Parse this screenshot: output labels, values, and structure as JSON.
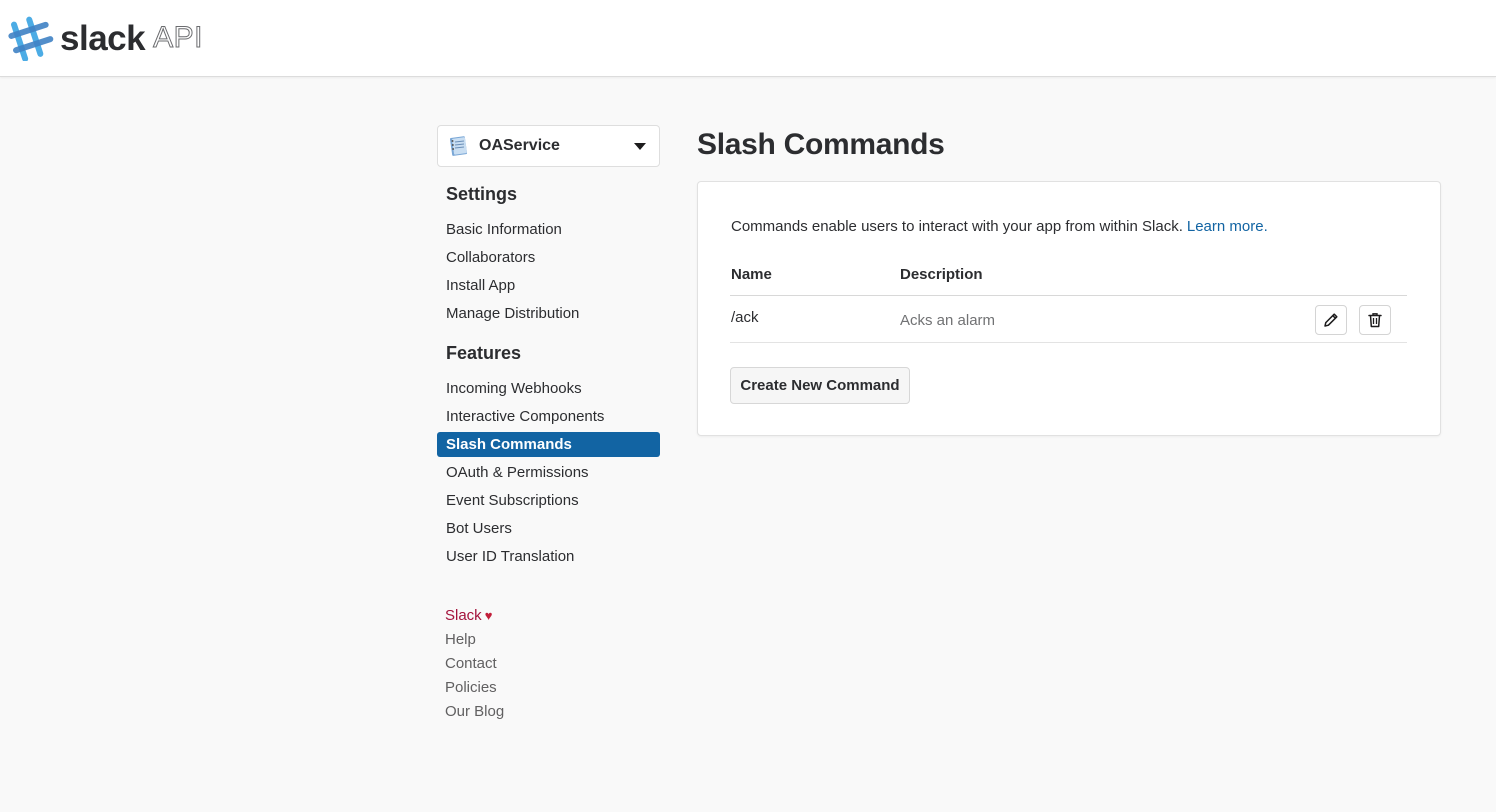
{
  "header": {
    "logo_word": "slack",
    "logo_suffix": "API"
  },
  "app_selector": {
    "app_name": "OAService"
  },
  "sidebar": {
    "settings_heading": "Settings",
    "settings_items": [
      {
        "label": "Basic Information"
      },
      {
        "label": "Collaborators"
      },
      {
        "label": "Install App"
      },
      {
        "label": "Manage Distribution"
      }
    ],
    "features_heading": "Features",
    "features_items": [
      {
        "label": "Incoming Webhooks"
      },
      {
        "label": "Interactive Components"
      },
      {
        "label": "Slash Commands",
        "active": true
      },
      {
        "label": "OAuth & Permissions"
      },
      {
        "label": "Event Subscriptions"
      },
      {
        "label": "Bot Users"
      },
      {
        "label": "User ID Translation"
      }
    ],
    "footer": {
      "slack": "Slack",
      "help": "Help",
      "contact": "Contact",
      "policies": "Policies",
      "blog": "Our Blog"
    }
  },
  "main": {
    "title": "Slash Commands",
    "intro_text": "Commands enable users to interact with your app from within Slack.",
    "learn_more": "Learn more.",
    "columns": {
      "name": "Name",
      "description": "Description"
    },
    "commands": [
      {
        "name": "/ack",
        "description": "Acks an alarm"
      }
    ],
    "create_button": "Create New Command"
  },
  "colors": {
    "accent": "#1264a3",
    "active_nav_bg": "#1264a3",
    "footer_slack": "#a4133c",
    "heart": "#c21f3a"
  },
  "icons": {
    "app": "notebook-icon",
    "edit": "pencil-icon",
    "delete": "trash-icon",
    "dropdown": "caret-down-icon",
    "love": "heart-icon"
  }
}
